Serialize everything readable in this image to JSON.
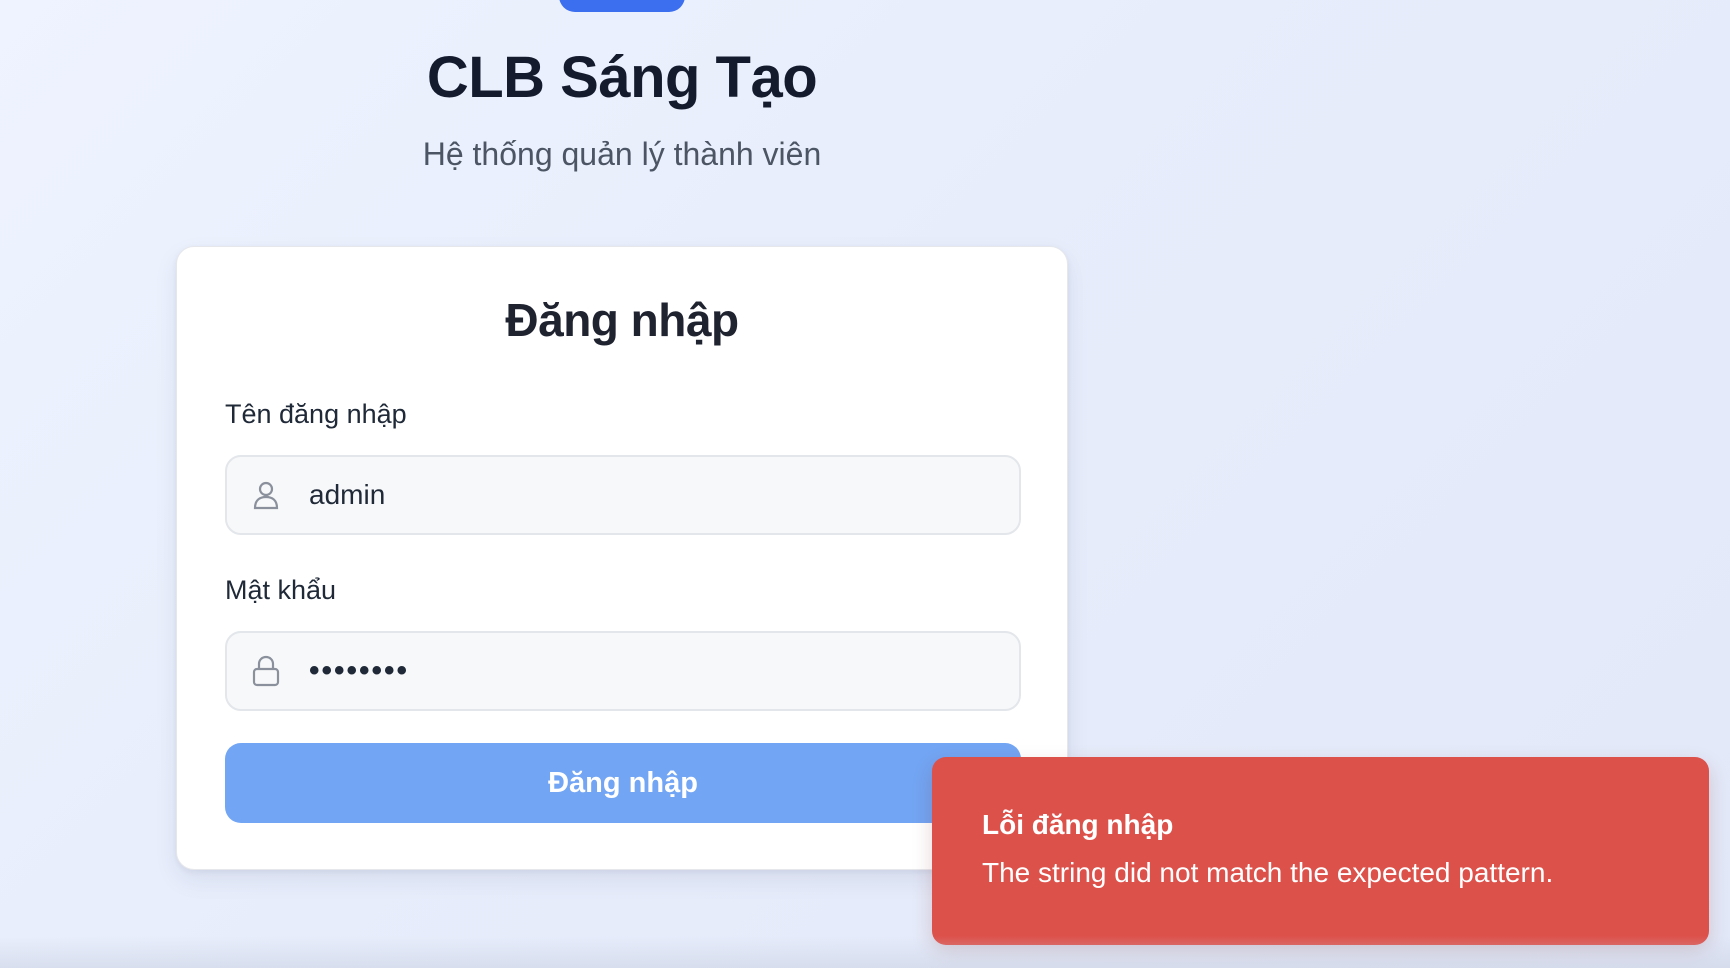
{
  "app": {
    "title": "CLB Sáng Tạo",
    "subtitle": "Hệ thống quản lý thành viên"
  },
  "login": {
    "heading": "Đăng nhập",
    "username": {
      "label": "Tên đăng nhập",
      "value": "admin",
      "icon": "user-icon"
    },
    "password": {
      "label": "Mật khẩu",
      "masked_value": "••••••••",
      "icon": "lock-icon"
    },
    "submit_label": "Đăng nhập"
  },
  "toast": {
    "title": "Lỗi đăng nhập",
    "message": "The string did not match the expected pattern.",
    "color": "#dd514b"
  },
  "colors": {
    "accent": "#3b6ff0",
    "button": "#72a5f3"
  }
}
